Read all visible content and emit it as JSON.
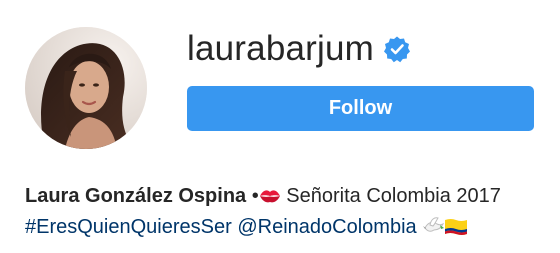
{
  "profile": {
    "username": "laurabarjum",
    "verified": true,
    "follow_label": "Follow",
    "full_name": "Laura González Ospina",
    "bio_separator": "•",
    "bio_line1_text": " Señorita Colombia 2017",
    "hashtag": "#EresQuienQuieresSer",
    "mention": "@ReinadoColombia"
  },
  "colors": {
    "follow_button": "#3897f0",
    "verified_badge": "#3897f0",
    "link": "#003569",
    "text": "#262626"
  },
  "icons": {
    "verified": "verified-badge-icon",
    "kiss": "kiss-mark-emoji",
    "dove": "dove-emoji",
    "flag": "colombia-flag-emoji"
  }
}
